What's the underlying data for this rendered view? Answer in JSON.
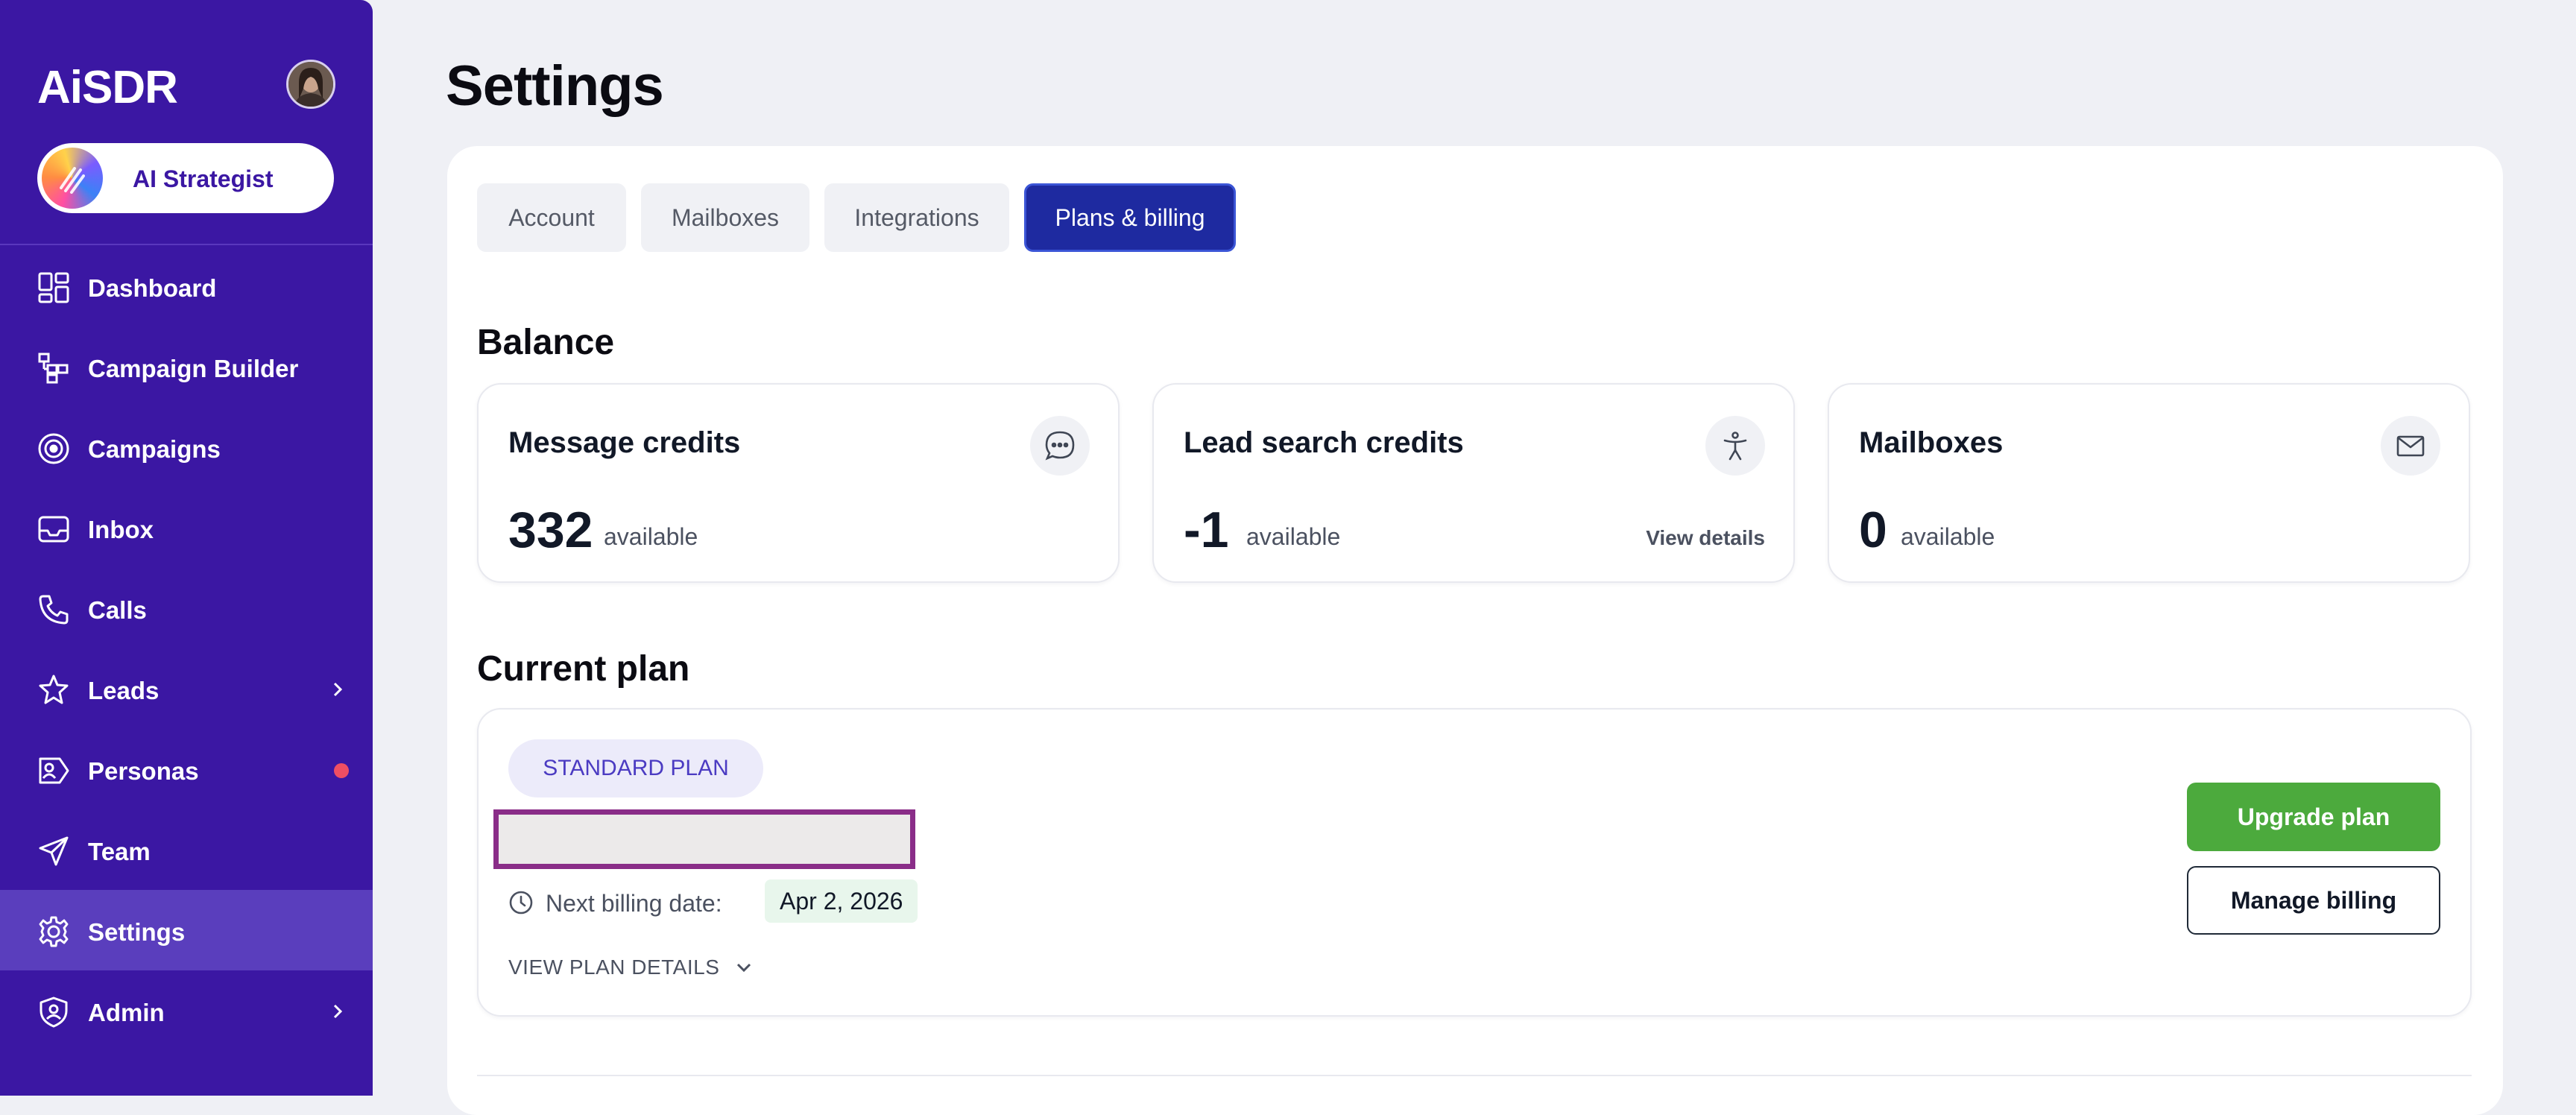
{
  "sidebar": {
    "logo": "AiSDR",
    "strategist_label": "AI Strategist",
    "items": [
      {
        "label": "Dashboard",
        "icon": "dashboard-icon"
      },
      {
        "label": "Campaign Builder",
        "icon": "campaign-builder-icon"
      },
      {
        "label": "Campaigns",
        "icon": "target-icon"
      },
      {
        "label": "Inbox",
        "icon": "inbox-icon"
      },
      {
        "label": "Calls",
        "icon": "phone-icon"
      },
      {
        "label": "Leads",
        "icon": "star-person-icon",
        "has_chevron": true
      },
      {
        "label": "Personas",
        "icon": "persona-tag-icon",
        "has_dot": true
      },
      {
        "label": "Team",
        "icon": "send-icon"
      },
      {
        "label": "Settings",
        "icon": "gear-icon",
        "active": true
      },
      {
        "label": "Admin",
        "icon": "shield-icon",
        "has_chevron": true
      }
    ]
  },
  "page": {
    "title": "Settings"
  },
  "tabs": [
    {
      "label": "Account"
    },
    {
      "label": "Mailboxes"
    },
    {
      "label": "Integrations"
    },
    {
      "label": "Plans & billing",
      "active": true
    }
  ],
  "balance": {
    "title": "Balance",
    "cards": [
      {
        "title": "Message credits",
        "value": "332",
        "sub": "available",
        "icon": "chat-bubble-icon"
      },
      {
        "title": "Lead search credits",
        "value": "-1",
        "sub": "available",
        "link": "View details",
        "icon": "accessibility-person-icon"
      },
      {
        "title": "Mailboxes",
        "value": "0",
        "sub": "available",
        "icon": "mail-icon"
      }
    ]
  },
  "current_plan": {
    "title": "Current plan",
    "badge": "STANDARD PLAN",
    "billing_label": "Next billing date:",
    "billing_date": "Apr 2, 2026",
    "view_details": "VIEW PLAN DETAILS",
    "upgrade_label": "Upgrade plan",
    "manage_label": "Manage billing"
  },
  "colors": {
    "sidebar_bg": "#3b17a3",
    "sidebar_active": "#5a3ebd",
    "tab_active": "#1e2aa0",
    "upgrade_green": "#4caa3d",
    "redaction_border": "#8a2d88",
    "notification_dot": "#ef4e63"
  }
}
